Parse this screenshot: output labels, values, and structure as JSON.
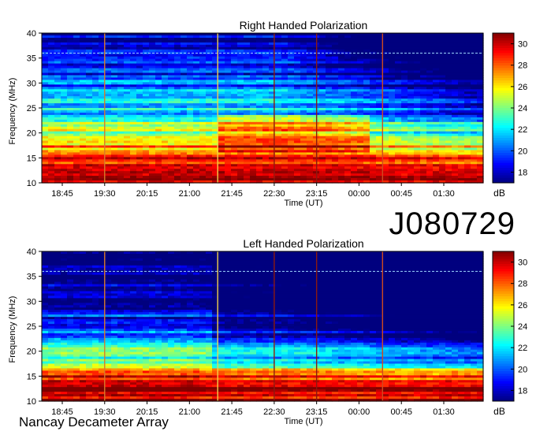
{
  "observation_id": "J080729",
  "instrument": "Nancay Decameter Array",
  "chart_data": [
    {
      "type": "heatmap",
      "title": "Right Handed Polarization",
      "xlabel": "Time (UT)",
      "ylabel": "Frequency (MHz)",
      "x_ticks": [
        "18:45",
        "19:30",
        "20:15",
        "21:00",
        "21:45",
        "22:30",
        "23:15",
        "00:00",
        "00:45",
        "01:30"
      ],
      "y_ticks": [
        10,
        15,
        20,
        25,
        30,
        35,
        40
      ],
      "ylim": [
        10,
        40
      ],
      "colorbar_ticks": [
        18,
        20,
        22,
        24,
        26,
        28,
        30
      ],
      "colorbar_range": [
        17,
        31
      ],
      "colorbar_label": "dB",
      "colorscale": [
        "#00007f",
        "#0000ff",
        "#007fff",
        "#00ffff",
        "#7fff7f",
        "#ffff00",
        "#ff7f00",
        "#ff0000",
        "#7f0000"
      ],
      "vertical_lines": [
        {
          "time": "19:30",
          "color": "#d87a2a"
        },
        {
          "time": "21:30",
          "color": "#f2d24a"
        },
        {
          "time": "22:30",
          "color": "#8b1a10"
        },
        {
          "time": "23:15",
          "color": "#8b1a10"
        },
        {
          "time": "00:25",
          "color": "#d04a20"
        }
      ]
    },
    {
      "type": "heatmap",
      "title": "Left Handed Polarization",
      "xlabel": "Time (UT)",
      "ylabel": "Frequency (MHz)",
      "x_ticks": [
        "18:45",
        "19:30",
        "20:15",
        "21:00",
        "21:45",
        "22:30",
        "23:15",
        "00:00",
        "00:45",
        "01:30"
      ],
      "y_ticks": [
        10,
        15,
        20,
        25,
        30,
        35,
        40
      ],
      "ylim": [
        10,
        40
      ],
      "colorbar_ticks": [
        18,
        20,
        22,
        24,
        26,
        28,
        30
      ],
      "colorbar_range": [
        17,
        31
      ],
      "colorbar_label": "dB",
      "colorscale": [
        "#00007f",
        "#0000ff",
        "#007fff",
        "#00ffff",
        "#7fff7f",
        "#ffff00",
        "#ff7f00",
        "#ff0000",
        "#7f0000"
      ],
      "vertical_lines": [
        {
          "time": "19:30",
          "color": "#d87a2a"
        },
        {
          "time": "21:30",
          "color": "#f2d24a"
        },
        {
          "time": "22:30",
          "color": "#8b1a10"
        },
        {
          "time": "23:15",
          "color": "#8b1a10"
        },
        {
          "time": "00:25",
          "color": "#d04a20"
        }
      ]
    }
  ]
}
